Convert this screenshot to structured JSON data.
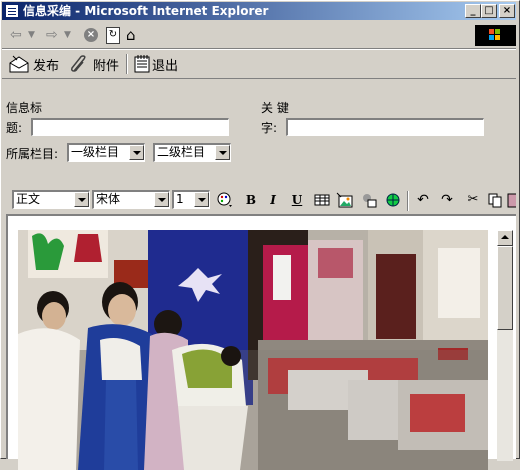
{
  "window": {
    "title": "信息采编 - Microsoft Internet Explorer"
  },
  "toolbar": {
    "publish_label": "发布",
    "attach_label": "附件",
    "exit_label": "退出"
  },
  "form": {
    "title_label_line1": "信息标",
    "title_label_line2": "题:",
    "title_value": "",
    "keyword_label_line1": "关 键",
    "keyword_label_line2": "字:",
    "keyword_value": "",
    "category_label": "所属栏目:",
    "level1_value": "一级栏目",
    "level2_value": "二级栏目"
  },
  "format": {
    "style_value": "正文",
    "font_value": "宋体",
    "size_value": "1"
  }
}
